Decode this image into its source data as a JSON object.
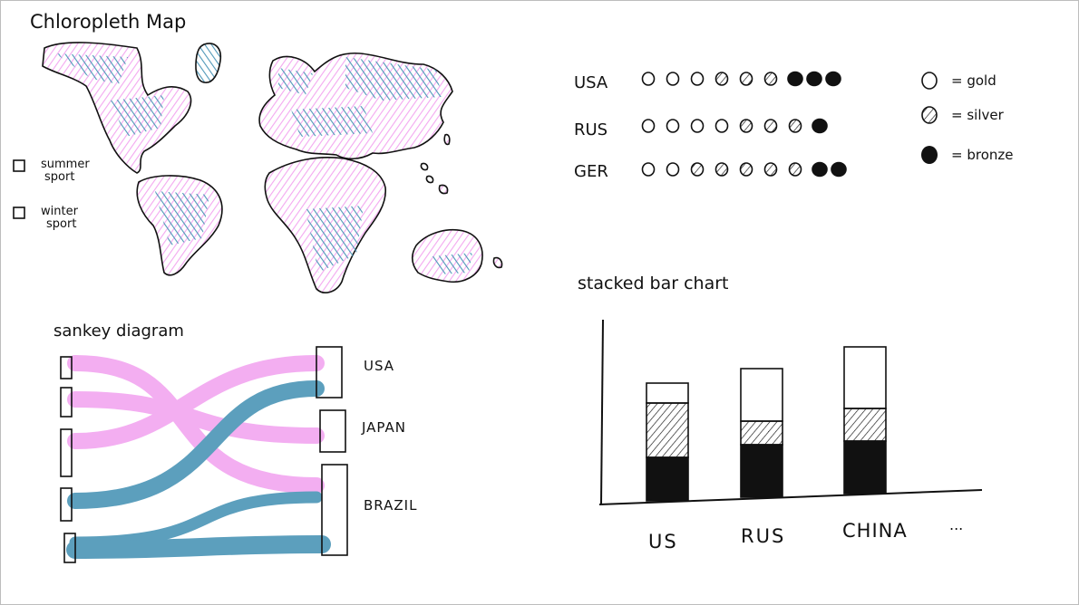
{
  "colors": {
    "pink": "#f3a8f0",
    "blue": "#4f97b8",
    "ink": "#111111"
  },
  "map": {
    "title": "Chloropleth Map",
    "legend": [
      {
        "label_line1": "summer",
        "label_line2": "sport"
      },
      {
        "label_line1": "winter",
        "label_line2": "sport"
      }
    ]
  },
  "medals": {
    "rows": [
      {
        "country": "USA",
        "gold": 3,
        "silver": 3,
        "bronze": 3
      },
      {
        "country": "RUS",
        "gold": 4,
        "silver": 3,
        "bronze": 1
      },
      {
        "country": "GER",
        "gold": 2,
        "silver": 5,
        "bronze": 2
      }
    ],
    "legend": {
      "gold": "= gold",
      "silver": "= silver",
      "bronze": "= bronze"
    }
  },
  "sankey": {
    "title": "sankey diagram",
    "targets": [
      "USA",
      "JAPAN",
      "BRAZIL"
    ]
  },
  "bar_chart": {
    "title": "stacked bar chart",
    "ellipsis": "...",
    "categories": [
      "US",
      "RUS",
      "CHINA"
    ]
  }
}
